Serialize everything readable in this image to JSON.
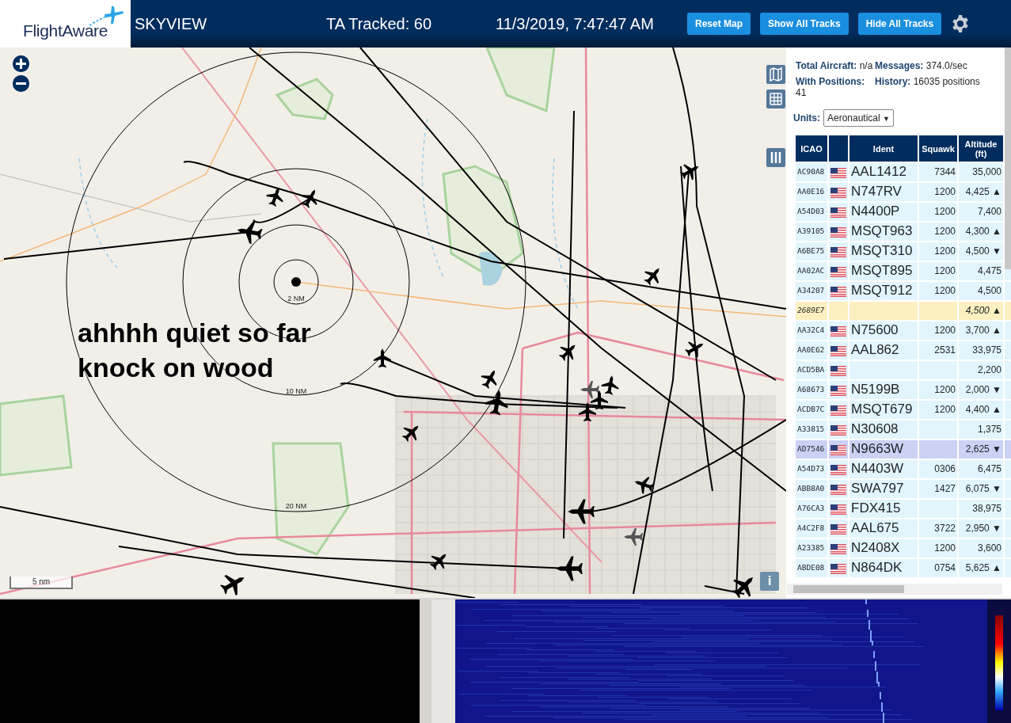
{
  "header": {
    "logo": "FlightAware",
    "title": "SKYVIEW",
    "tracked": "TA Tracked: 60",
    "datetime": "11/3/2019, 7:47:47 AM",
    "buttons": [
      "Reset Map",
      "Show All Tracks",
      "Hide All Tracks"
    ]
  },
  "map": {
    "annotation": "ahhhh quiet so far knock on wood",
    "range_labels": [
      "2 NM",
      "10 NM",
      "20 NM"
    ],
    "scale": "5 nm",
    "info_button": "i"
  },
  "stats": [
    {
      "label": "Total Aircraft:",
      "value": "n/a"
    },
    {
      "label": "Messages:",
      "value": "374.0/sec"
    },
    {
      "label": "With Positions:",
      "value": "41"
    },
    {
      "label": "History:",
      "value": "16035 positions"
    }
  ],
  "units": {
    "label": "Units:",
    "value": "Aeronautical",
    "arrow": "▼"
  },
  "table": {
    "columns": [
      "ICAO",
      "Ident",
      "Squawk",
      "Altitude (ft)"
    ],
    "rows": [
      {
        "icao": "AC90A8",
        "flag": true,
        "ident": "AAL1412",
        "squawk": "7344",
        "altitude": "35,000",
        "kind": "adsb",
        "selected": false
      },
      {
        "icao": "AA0E16",
        "flag": true,
        "ident": "N747RV",
        "squawk": "1200",
        "altitude": "4,425",
        "trend": "▲",
        "kind": "adsb",
        "selected": false
      },
      {
        "icao": "A54D03",
        "flag": true,
        "ident": "N4400P",
        "squawk": "1200",
        "altitude": "7,400",
        "kind": "adsb",
        "selected": false
      },
      {
        "icao": "A39105",
        "flag": true,
        "ident": "MSQT963",
        "squawk": "1200",
        "altitude": "4,300",
        "trend": "▲",
        "kind": "adsb",
        "selected": false
      },
      {
        "icao": "A6BE75",
        "flag": true,
        "ident": "MSQT310",
        "squawk": "1200",
        "altitude": "4,500",
        "trend": "▼",
        "kind": "adsb",
        "selected": false
      },
      {
        "icao": "AA02AC",
        "flag": true,
        "ident": "MSQT895",
        "squawk": "1200",
        "altitude": "4,475",
        "kind": "adsb",
        "selected": false
      },
      {
        "icao": "A34207",
        "flag": true,
        "ident": "MSQT912",
        "squawk": "1200",
        "altitude": "4,500",
        "kind": "adsb",
        "selected": false
      },
      {
        "icao": "2689E7",
        "flag": false,
        "altitude": "4,500",
        "trend": "▲",
        "kind": "tisb",
        "selected": false
      },
      {
        "icao": "AA32C4",
        "flag": true,
        "ident": "N75600",
        "squawk": "1200",
        "altitude": "3,700",
        "trend": "▲",
        "kind": "adsb",
        "selected": false
      },
      {
        "icao": "AA0E62",
        "flag": true,
        "ident": "AAL862",
        "squawk": "2531",
        "altitude": "33,975",
        "kind": "adsb",
        "selected": false
      },
      {
        "icao": "ACD5BA",
        "flag": true,
        "altitude": "2,200",
        "kind": "adsb",
        "selected": false
      },
      {
        "icao": "A68673",
        "flag": true,
        "ident": "N5199B",
        "squawk": "1200",
        "altitude": "2,000",
        "trend": "▼",
        "kind": "adsb",
        "selected": false
      },
      {
        "icao": "ACDB7C",
        "flag": true,
        "ident": "MSQT679",
        "squawk": "1200",
        "altitude": "4,400",
        "trend": "▲",
        "kind": "adsb",
        "selected": false
      },
      {
        "icao": "A33815",
        "flag": true,
        "ident": "N30608",
        "altitude": "1,375",
        "kind": "adsb",
        "selected": false
      },
      {
        "icao": "AD7546",
        "flag": true,
        "ident": "N9663W",
        "altitude": "2,625",
        "trend": "▼",
        "kind": "adsb",
        "selected": true
      },
      {
        "icao": "A54D73",
        "flag": true,
        "ident": "N4403W",
        "squawk": "0306",
        "altitude": "6,475",
        "kind": "adsb",
        "selected": false
      },
      {
        "icao": "ABB8A0",
        "flag": true,
        "ident": "SWA797",
        "squawk": "1427",
        "altitude": "6,075",
        "trend": "▼",
        "kind": "adsb",
        "selected": false
      },
      {
        "icao": "A76CA3",
        "flag": true,
        "ident": "FDX415",
        "altitude": "38,975",
        "kind": "adsb",
        "selected": false
      },
      {
        "icao": "A4C2F8",
        "flag": true,
        "ident": "AAL675",
        "squawk": "3722",
        "altitude": "2,950",
        "trend": "▼",
        "kind": "adsb",
        "selected": false
      },
      {
        "icao": "A23385",
        "flag": true,
        "ident": "N2408X",
        "squawk": "1200",
        "altitude": "3,600",
        "kind": "adsb",
        "selected": false
      },
      {
        "icao": "ABDE08",
        "flag": true,
        "ident": "N864DK",
        "squawk": "0754",
        "altitude": "5,625",
        "trend": "▲",
        "kind": "adsb",
        "selected": false
      }
    ]
  }
}
